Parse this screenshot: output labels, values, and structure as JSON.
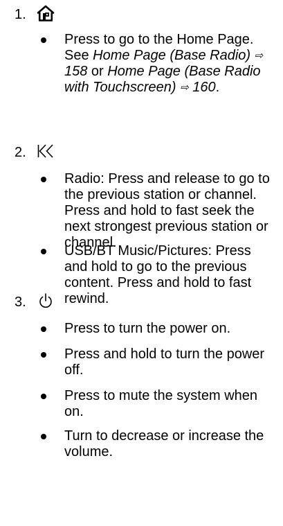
{
  "steps": [
    {
      "number": "1.",
      "icon": "home-icon",
      "bullets": [
        {
          "text_a": "Press to go to the Home Page. See ",
          "ref_a": "Home Page (Base Radio)",
          "arrow_a": "⇨",
          "page_a": "158",
          "text_b": " or ",
          "ref_b": "Home Page (Base Radio with Touchscreen)",
          "arrow_b": "⇨",
          "page_b": "160",
          "text_c": "."
        }
      ]
    },
    {
      "number": "2.",
      "icon": "seek-back-icon",
      "bullets": [
        {
          "text": "Radio: Press and release to go to the previous station or channel. Press and hold to fast seek the next strongest previous station or channel."
        },
        {
          "text": "USB/BT Music/Pictures: Press and hold to go to the previous content. Press and hold to fast rewind."
        }
      ]
    },
    {
      "number": "3.",
      "icon": "power-icon",
      "bullets": [
        {
          "text": "Press to turn the power on."
        },
        {
          "text": "Press and hold to turn the power off."
        },
        {
          "text": "Press to mute the system when on."
        },
        {
          "text": "Turn to decrease or increase the volume."
        }
      ]
    }
  ]
}
